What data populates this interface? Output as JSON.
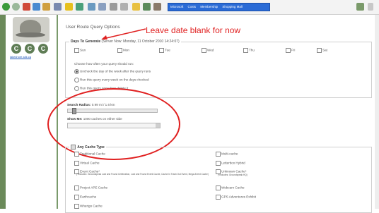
{
  "toolbar": {
    "tabs": [
      {
        "icon": "globe-icon",
        "label": "Microsoft"
      },
      {
        "icon": "globe-icon",
        "label": "Costs"
      },
      {
        "icon": "globe-icon",
        "label": "Membership"
      },
      {
        "icon": "globe-icon",
        "label": "Shopping Mall"
      }
    ]
  },
  "sidebar": {
    "logo_letters": [
      "C",
      "C",
      "C"
    ],
    "link": "lakeshore.sdk.ca"
  },
  "page": {
    "title": "User Route Query Options",
    "annotation": "Leave date blank for now"
  },
  "days": {
    "legend": "Days To Generate",
    "server_time": "(Server Now: Monday, 11 October 2010 14:24:07)",
    "items": [
      "Sun",
      "Mon",
      "Tue",
      "Wed",
      "Thu",
      "Fri",
      "Sat"
    ],
    "prompt": "Choose how often your query should run:",
    "options": [
      {
        "label": "Uncheck the day of the week after the query runs",
        "selected": true
      },
      {
        "label": "Run this query every week on the days checked",
        "selected": false
      },
      {
        "label": "Run this query once then delete it",
        "selected": false
      }
    ]
  },
  "search_radius": {
    "label": "Search Radius:",
    "value": "0.99 mi / 1.6 km",
    "level": 0.05
  },
  "show_me": {
    "label": "Show Me:",
    "value": "1000 caches on either side"
  },
  "cache_types": {
    "legend": "Any Cache Type",
    "items": [
      {
        "label": "Traditional Cache",
        "note": ""
      },
      {
        "label": "Multi-cache",
        "note": ""
      },
      {
        "label": "Virtual Cache",
        "note": ""
      },
      {
        "label": "Letterbox Hybrid",
        "note": ""
      },
      {
        "label": "Event Cache*",
        "note": "(*Includes: Groundspeak Lost and Found Celebration, Lost and Found Event Cache, Cache In Trash Out Event, Mega-Event Cache)"
      },
      {
        "label": "Unknown Cache*",
        "note": "(*Includes: Groundspeak HQ)"
      },
      {
        "label": "Project APE Cache",
        "note": ""
      },
      {
        "label": "Webcam Cache",
        "note": ""
      },
      {
        "label": "Earthcache",
        "note": ""
      },
      {
        "label": "GPS Adventures Exhibit",
        "note": ""
      },
      {
        "label": "Wherigo Cache",
        "note": ""
      }
    ]
  }
}
